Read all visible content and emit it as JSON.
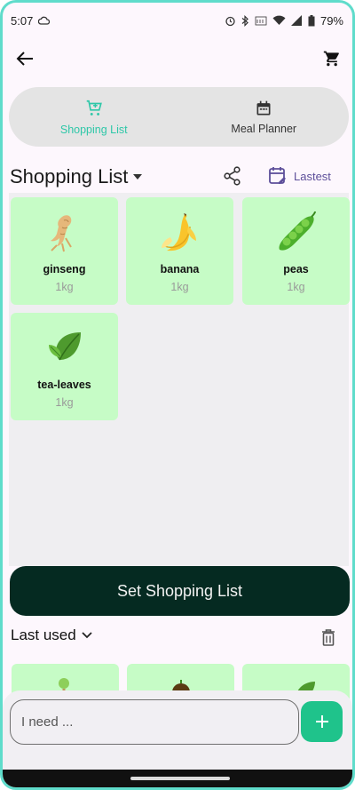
{
  "status_bar": {
    "time": "5:07",
    "battery": "79%"
  },
  "tabs": [
    {
      "label": "Shopping List",
      "icon": "cart-icon",
      "active": true
    },
    {
      "label": "Meal Planner",
      "icon": "calendar-icon",
      "active": false
    }
  ],
  "list_header": {
    "title": "Shopping List",
    "sort_label": "Lastest"
  },
  "items": [
    {
      "name": "ginseng",
      "qty": "1kg",
      "emoji": "🫚"
    },
    {
      "name": "banana",
      "qty": "1kg",
      "emoji": "🍌"
    },
    {
      "name": "peas",
      "qty": "1kg",
      "emoji": "🫛"
    },
    {
      "name": "tea-leaves",
      "qty": "1kg",
      "emoji": "🌿"
    }
  ],
  "set_button_label": "Set Shopping List",
  "last_used": {
    "title": "Last used"
  },
  "input": {
    "placeholder": "I need ...",
    "value": ""
  },
  "colors": {
    "accent": "#2ec7a8",
    "card_bg": "#c6fcc6",
    "cta_bg": "#052a21",
    "add_btn": "#1fc38b"
  }
}
